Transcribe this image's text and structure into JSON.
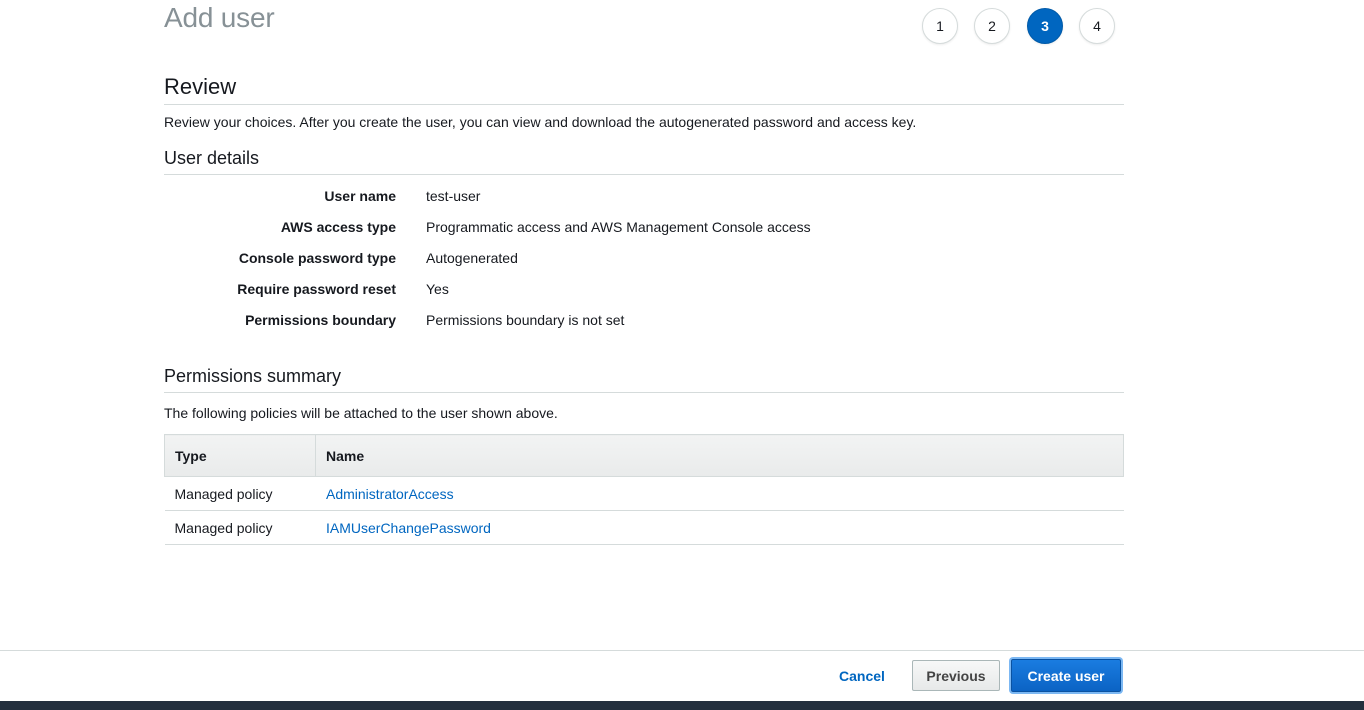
{
  "page": {
    "title": "Add user"
  },
  "steps": [
    {
      "label": "1",
      "active": false
    },
    {
      "label": "2",
      "active": false
    },
    {
      "label": "3",
      "active": true
    },
    {
      "label": "4",
      "active": false
    }
  ],
  "review": {
    "title": "Review",
    "description": "Review your choices. After you create the user, you can view and download the autogenerated password and access key."
  },
  "user_details": {
    "title": "User details",
    "rows": [
      {
        "label": "User name",
        "value": "test-user"
      },
      {
        "label": "AWS access type",
        "value": "Programmatic access and AWS Management Console access"
      },
      {
        "label": "Console password type",
        "value": "Autogenerated"
      },
      {
        "label": "Require password reset",
        "value": "Yes"
      },
      {
        "label": "Permissions boundary",
        "value": "Permissions boundary is not set"
      }
    ]
  },
  "permissions": {
    "title": "Permissions summary",
    "description": "The following policies will be attached to the user shown above.",
    "columns": [
      "Type",
      "Name"
    ],
    "rows": [
      {
        "type": "Managed policy",
        "name": "AdministratorAccess"
      },
      {
        "type": "Managed policy",
        "name": "IAMUserChangePassword"
      }
    ]
  },
  "footer": {
    "cancel_label": "Cancel",
    "previous_label": "Previous",
    "create_label": "Create user"
  },
  "colors": {
    "accent": "#0066c0",
    "primary_button": "#0b63c4",
    "bottom_bar": "#232f3e"
  }
}
